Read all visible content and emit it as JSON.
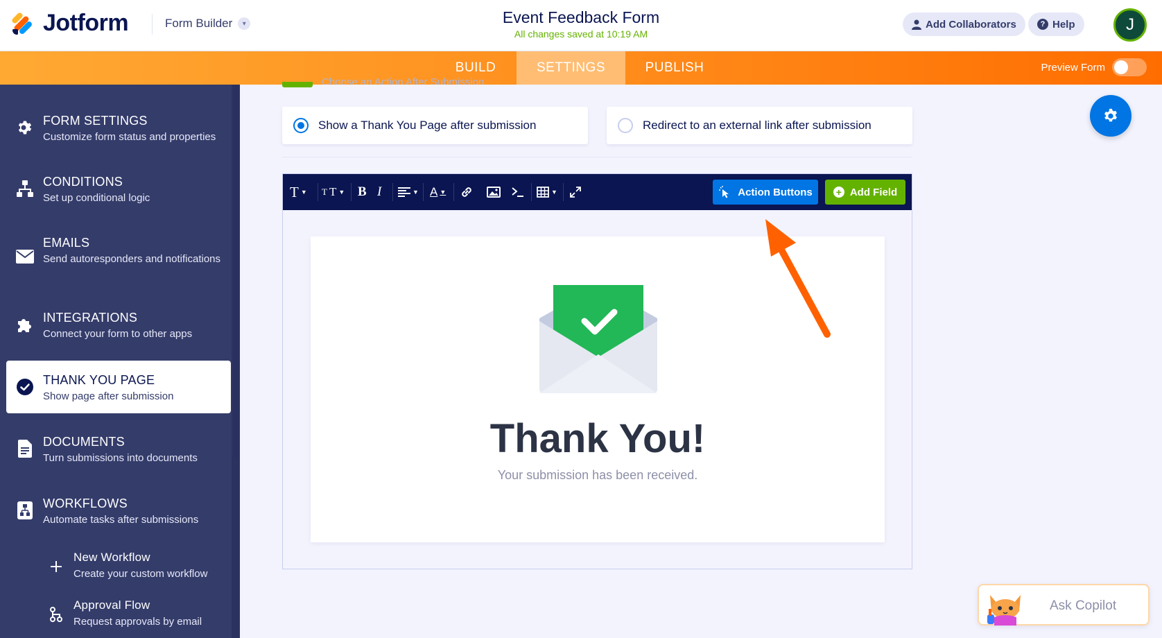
{
  "header": {
    "logo_text": "Jotform",
    "form_builder_label": "Form Builder",
    "form_title": "Event Feedback Form",
    "saved_status": "All changes saved at 10:19 AM",
    "add_collaborators_label": "Add Collaborators",
    "help_label": "Help",
    "avatar_initial": "J"
  },
  "tabs": [
    {
      "label": "BUILD",
      "active": false
    },
    {
      "label": "SETTINGS",
      "active": true
    },
    {
      "label": "PUBLISH",
      "active": false
    }
  ],
  "preview_form_label": "Preview Form",
  "sidebar": {
    "items": [
      {
        "title": "FORM SETTINGS",
        "subtitle": "Customize form status and properties",
        "icon": "gear-icon"
      },
      {
        "title": "CONDITIONS",
        "subtitle": "Set up conditional logic",
        "icon": "conditions-icon"
      },
      {
        "title": "EMAILS",
        "subtitle": "Send autoresponders and notifications",
        "icon": "envelope-icon"
      },
      {
        "title": "INTEGRATIONS",
        "subtitle": "Connect your form to other apps",
        "icon": "puzzle-icon"
      },
      {
        "title": "THANK YOU PAGE",
        "subtitle": "Show page after submission",
        "icon": "check-circle-icon",
        "active": true
      },
      {
        "title": "DOCUMENTS",
        "subtitle": "Turn submissions into documents",
        "icon": "document-icon"
      },
      {
        "title": "WORKFLOWS",
        "subtitle": "Automate tasks after submissions",
        "icon": "workflow-icon"
      }
    ],
    "children": [
      {
        "title": "New Workflow",
        "subtitle": "Create your custom workflow",
        "icon": "plus-icon"
      },
      {
        "title": "Approval Flow",
        "subtitle": "Request approvals by email",
        "icon": "approval-flow-icon"
      }
    ]
  },
  "main": {
    "section_hint": "Choose an Action After Submission",
    "options": [
      {
        "label": "Show a Thank You Page after submission",
        "selected": true
      },
      {
        "label": "Redirect to an external link after submission",
        "selected": false
      }
    ],
    "action_buttons_label": "Action Buttons",
    "add_field_label": "Add Field",
    "thank_you_title": "Thank You!",
    "thank_you_message": "Your submission has been received."
  },
  "copilot_label": "Ask Copilot",
  "colors": {
    "brand_orange": "#ff8b1a",
    "sidebar": "#343c6a",
    "toolbar": "#0a1551",
    "blue": "#0075e3",
    "green": "#64b200"
  }
}
